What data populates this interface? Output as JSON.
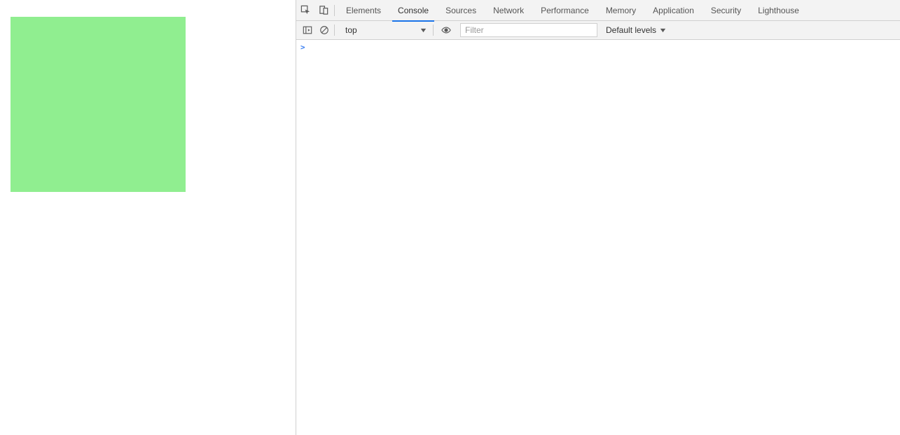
{
  "page": {
    "box_color": "#90ee90"
  },
  "devtools": {
    "tabs": [
      {
        "label": "Elements",
        "active": false
      },
      {
        "label": "Console",
        "active": true
      },
      {
        "label": "Sources",
        "active": false
      },
      {
        "label": "Network",
        "active": false
      },
      {
        "label": "Performance",
        "active": false
      },
      {
        "label": "Memory",
        "active": false
      },
      {
        "label": "Application",
        "active": false
      },
      {
        "label": "Security",
        "active": false
      },
      {
        "label": "Lighthouse",
        "active": false
      }
    ],
    "toolbar": {
      "context": "top",
      "filter_placeholder": "Filter",
      "levels_label": "Default levels"
    },
    "console": {
      "prompt": ">"
    }
  }
}
